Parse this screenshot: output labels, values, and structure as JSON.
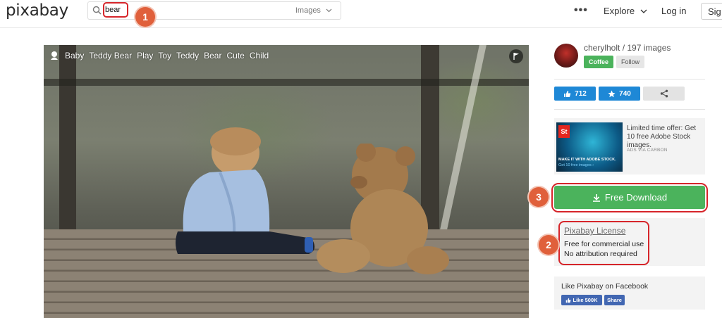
{
  "header": {
    "logo": "pixabay",
    "search": {
      "query": "bear",
      "filter_label": "Images"
    },
    "menu_dots": "•••",
    "explore_label": "Explore",
    "login_label": "Log in",
    "signup_label": "Sig"
  },
  "annotations": [
    "1",
    "2",
    "3"
  ],
  "image": {
    "tags": [
      "Baby",
      "Teddy Bear",
      "Play",
      "Toy",
      "Teddy",
      "Bear",
      "Cute",
      "Child"
    ]
  },
  "sidebar": {
    "author": "cherylholt / 197 images",
    "coffee_label": "Coffee",
    "follow_label": "Follow",
    "likes": "712",
    "favorites": "740",
    "ad": {
      "caption_line1": "MAKE IT WITH ADOBE STOCK.",
      "caption_line2": "Get 10 free images ›",
      "logo_text": "St",
      "text": "Limited time offer: Get 10 free Adobe Stock images.",
      "via": "ADS VIA CARBON"
    },
    "download_label": "Free Download",
    "license": {
      "title": "Pixabay License",
      "line1": "Free for commercial use",
      "line2": "No attribution required"
    },
    "facebook": {
      "title": "Like Pixabay on Facebook",
      "like_label": "Like 500K",
      "share_label": "Share"
    }
  },
  "colors": {
    "green": "#4bb35c",
    "blue": "#1e88d6",
    "callout_red": "#d6252a",
    "badge_orange": "#e0603b",
    "facebook_blue": "#4267b2"
  }
}
